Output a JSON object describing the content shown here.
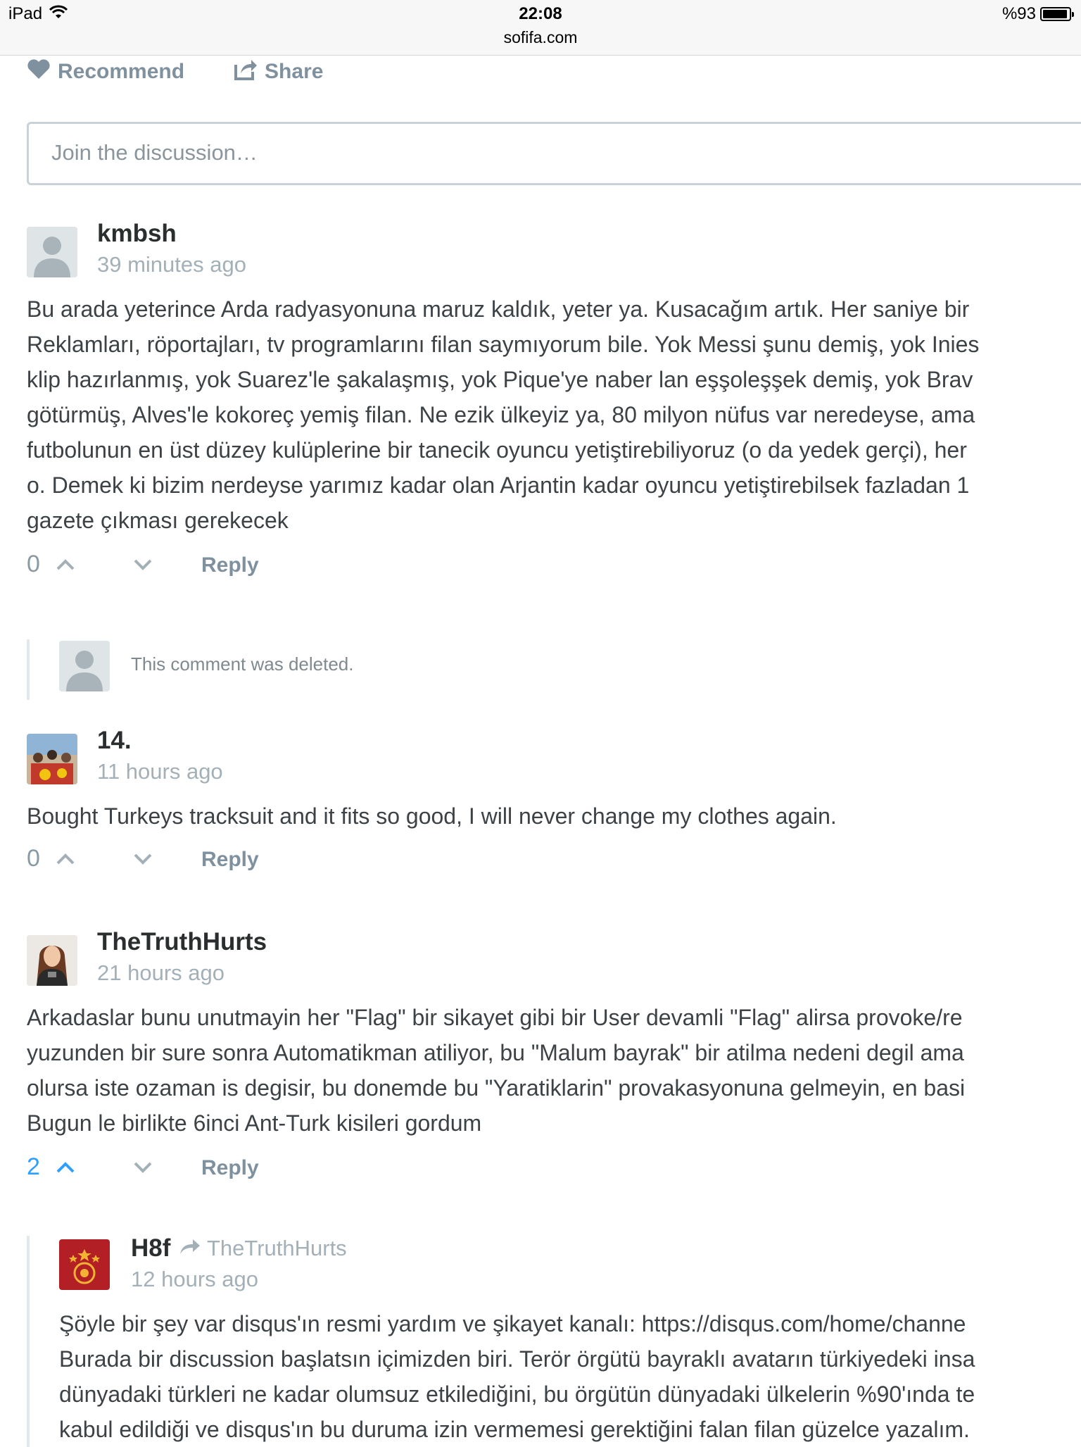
{
  "status_bar": {
    "device": "iPad",
    "time": "22:08",
    "url": "sofifa.com",
    "battery": "%93",
    "battery_level": 0.93
  },
  "actions": {
    "recommend": "Recommend",
    "share": "Share"
  },
  "composer": {
    "placeholder": "Join the discussion…"
  },
  "comments": [
    {
      "username": "kmbsh",
      "time": "39 minutes ago",
      "lines": [
        "Bu arada yeterince Arda radyasyonuna maruz kaldık, yeter ya. Kusacağım artık. Her saniye bir",
        "Reklamları, röportajları, tv programlarını filan saymıyorum bile. Yok Messi şunu demiş, yok Inies",
        "klip hazırlanmış, yok Suarez'le şakalaşmış, yok Pique'ye naber lan eşşoleşşek demiş, yok Brav",
        "götürmüş, Alves'le kokoreç yemiş filan. Ne ezik ülkeyiz ya, 80 milyon nüfus var neredeyse, ama",
        "futbolunun en üst düzey kulüplerine bir tanecik oyuncu yetiştirebiliyoruz (o da yedek gerçi), her",
        "o. Demek ki bizim nerdeyse yarımız kadar olan Arjantin kadar oyuncu yetiştirebilsek fazladan 1",
        "gazete çıkması gerekecek"
      ],
      "votes": "0",
      "reply": "Reply"
    },
    {
      "username": "14.",
      "time": "11 hours ago",
      "lines": [
        "Bought Turkeys tracksuit and it fits so good, I will never change my clothes again."
      ],
      "votes": "0",
      "reply": "Reply"
    },
    {
      "username": "TheTruthHurts",
      "time": "21 hours ago",
      "lines": [
        "Arkadaslar bunu unutmayin her \"Flag\" bir sikayet gibi bir User devamli \"Flag\" alirsa provoke/re",
        "yuzunden bir sure sonra Automatikman atiliyor, bu \"Malum bayrak\" bir atilma nedeni degil ama",
        "olursa iste ozaman is degisir, bu donemde bu \"Yaratiklarin\" provakasyonuna gelmeyin, en basi",
        "Bugun le birlikte 6inci Ant-Turk kisileri gordum"
      ],
      "votes": "2",
      "reply": "Reply"
    }
  ],
  "deleted_comment": {
    "text": "This comment was deleted."
  },
  "reply_comment": {
    "username": "H8f",
    "parent": "TheTruthHurts",
    "time": "12 hours ago",
    "lines": [
      "Şöyle bir şey var disqus'ın resmi yardım ve şikayet kanalı: https://disqus.com/home/channe",
      "Burada bir discussion başlatsın içimizden biri. Terör örgütü bayraklı avatarın türkiyedeki insa",
      "dünyadaki türkleri ne kadar olumsuz etkilediğini, bu örgütün dünyadaki ülkelerin %90'ında te",
      "kabul edildiği ve disqus'ın bu duruma izin vermemesi gerektiğini falan filan güzelce yazalım."
    ]
  },
  "colors": {
    "upvoted": "#2e9fff",
    "muted": "#7f919e",
    "timestamp": "#a3b0b8"
  }
}
